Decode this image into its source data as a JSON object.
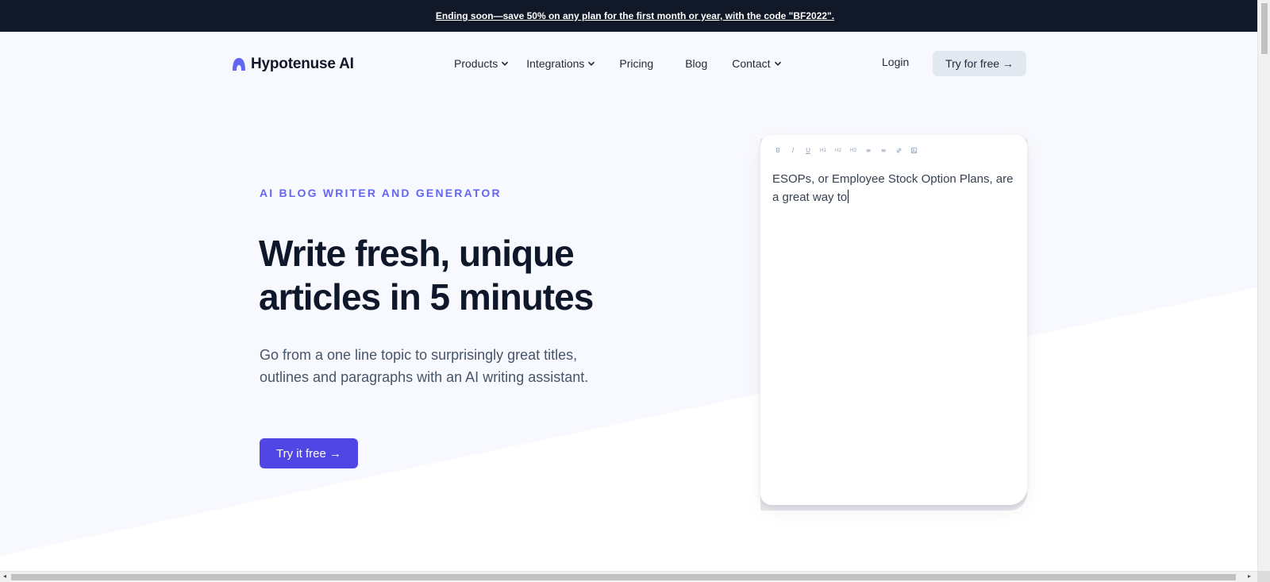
{
  "announcement": {
    "text": "Ending soon—save 50% on any plan for the first month or year, with the code \"BF2022\"."
  },
  "brand": {
    "name": "Hypotenuse AI",
    "logo_icon": "arch-logo-icon",
    "accent_color": "#6366f1"
  },
  "nav": {
    "items": [
      {
        "label": "Products",
        "has_dropdown": true
      },
      {
        "label": "Integrations",
        "has_dropdown": true
      },
      {
        "label": "Pricing",
        "has_dropdown": false
      },
      {
        "label": "Blog",
        "has_dropdown": false
      },
      {
        "label": "Contact",
        "has_dropdown": true
      }
    ],
    "login_label": "Login",
    "try_label": "Try for free →"
  },
  "hero": {
    "eyebrow": "AI BLOG WRITER AND GENERATOR",
    "headline": "Write fresh, unique articles in 5 minutes",
    "subtext": "Go from a one line topic to surprisingly great titles, outlines and paragraphs with an AI writing assistant.",
    "cta_label": "Try it free →",
    "cta_color": "#4f46e5"
  },
  "editor": {
    "toolbar": [
      {
        "name": "bold",
        "glyph": "B"
      },
      {
        "name": "italic",
        "glyph": "I"
      },
      {
        "name": "underline",
        "glyph": "U"
      },
      {
        "name": "heading-1",
        "glyph": "H1"
      },
      {
        "name": "heading-2",
        "glyph": "H2"
      },
      {
        "name": "heading-3",
        "glyph": "H3"
      },
      {
        "name": "bullet-list",
        "glyph": "≡"
      },
      {
        "name": "numbered-list",
        "glyph": "≡"
      },
      {
        "name": "link",
        "glyph": "🔗"
      },
      {
        "name": "image",
        "glyph": "▣"
      }
    ],
    "text": "ESOPs, or Employee Stock Option Plans, are a great way to"
  }
}
